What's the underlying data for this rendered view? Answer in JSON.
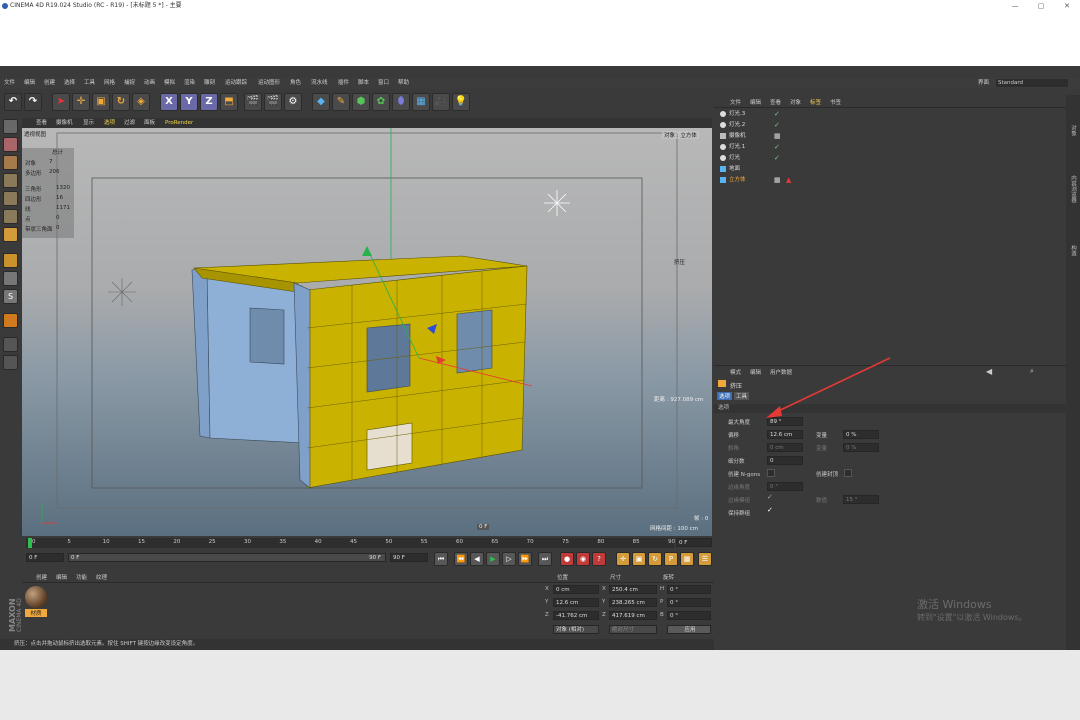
{
  "window": {
    "title": "CINEMA 4D R19.024 Studio (RC - R19) - [未标题 5 *] - 主要",
    "controls": [
      "—",
      "▢",
      "✕"
    ]
  },
  "menu": [
    "文件",
    "编辑",
    "创建",
    "选择",
    "工具",
    "网格",
    "捕捉",
    "动画",
    "模拟",
    "渲染",
    "雕刻",
    "运动跟踪",
    "运动图形",
    "角色",
    "流水线",
    "插件",
    "脚本",
    "窗口",
    "帮助"
  ],
  "layout": {
    "label": "界面",
    "value": "Standard"
  },
  "toolbar": {
    "undo_icon": "undo-icon",
    "axis_labels": [
      "X",
      "Y",
      "Z"
    ]
  },
  "viewport": {
    "tabs": [
      "查看",
      "摄像机",
      "显示",
      "选项",
      "过滤",
      "面板",
      "ProRender"
    ],
    "name": "透视视图",
    "object_label": "对象 : 立方体",
    "tool_label": "挤压",
    "distance": "距离 : 927.089 cm",
    "grid_spacing": "网格间距 : 100 cm",
    "frame_label": "帧 : 0",
    "frame_box": "0 F",
    "stats": {
      "header": "总计",
      "rows": [
        {
          "k": "对象",
          "v": "7"
        },
        {
          "k": "多边形",
          "v": "206"
        },
        {
          "k": "三角形",
          "v": "1320"
        },
        {
          "k": "四边形",
          "v": "16"
        },
        {
          "k": "线",
          "v": "1171"
        },
        {
          "k": "点",
          "v": "0"
        },
        {
          "k": "带状三角面",
          "v": "0"
        }
      ]
    }
  },
  "timeline": {
    "ticks": [
      "0",
      "5",
      "10",
      "15",
      "20",
      "25",
      "30",
      "35",
      "40",
      "45",
      "50",
      "55",
      "60",
      "65",
      "70",
      "75",
      "80",
      "85",
      "90"
    ],
    "current": "0 F",
    "start": "0 F",
    "min": "0 F",
    "max": "90 F",
    "end": "90 F"
  },
  "materials": {
    "menu": [
      "创建",
      "编辑",
      "功能",
      "纹理"
    ],
    "items": [
      {
        "name": "材质"
      }
    ],
    "brand": [
      "MAXON",
      "CINEMA 4D"
    ]
  },
  "coords": {
    "headers": [
      "位置",
      "尺寸",
      "旋转"
    ],
    "rows": [
      {
        "a": "X",
        "pos": "0 cm",
        "b": "X",
        "size": "250.4 cm",
        "c": "H",
        "rot": "0 °"
      },
      {
        "a": "Y",
        "pos": "12.6 cm",
        "b": "Y",
        "size": "238.265 cm",
        "c": "P",
        "rot": "0 °"
      },
      {
        "a": "Z",
        "pos": "-41.762 cm",
        "b": "Z",
        "size": "417.619 cm",
        "c": "B",
        "rot": "0 °"
      }
    ],
    "mode": "对象 (相对)",
    "size_mode": "绝对尺寸",
    "apply": "应用"
  },
  "status": "挤压：点击并拖动鼠标挤出选取元素。按住 SHIFT 键按边缘改变设定角度。",
  "objects": {
    "menu": [
      "文件",
      "编辑",
      "查看",
      "对象",
      "标签",
      "书签"
    ],
    "rows": [
      {
        "name": "灯光.3",
        "color": "#d8d8d8"
      },
      {
        "name": "灯光.2",
        "color": "#d8d8d8"
      },
      {
        "name": "摄像机",
        "color": "#d8d8d8"
      },
      {
        "name": "灯光.1",
        "color": "#d8d8d8"
      },
      {
        "name": "灯光",
        "color": "#d8d8d8"
      },
      {
        "name": "地面",
        "color": "#d8d8d8"
      },
      {
        "name": "立方体",
        "color": "#f2a93b"
      }
    ]
  },
  "attributes": {
    "menu": [
      "模式",
      "编辑",
      "用户数据"
    ],
    "title": "挤压",
    "tabs": [
      "选项",
      "工具"
    ],
    "section": "选项",
    "max_angle_label": "最大角度",
    "max_angle": "89 °",
    "offset_label": "偏移",
    "offset": "12.6 cm",
    "var1_label": "变量",
    "var1": "0 %",
    "bevel_label": "斜角",
    "bevel": "0 cm",
    "var2_label": "变量",
    "var2": "0 %",
    "subdiv_label": "细分数",
    "subdiv": "0",
    "ngons_label": "创建 N-gons",
    "cap_label": "创建封顶",
    "edge_angle_label": "边缘角度",
    "edge_angle": "0 °",
    "edge_mode_label": "边缘模组",
    "value_label": "数值",
    "value": "15 °",
    "keep_groups_label": "保持群组"
  },
  "sidetabs": [
    "对象",
    "内容浏览器",
    "构造"
  ],
  "activate": {
    "line1": "激活 Windows",
    "line2": "转到\"设置\"以激活 Windows。"
  },
  "colors": {
    "accent": "#f2a93b",
    "selected": "#ffb400",
    "arrow": "#e53935",
    "model_yellow": "#c9b200",
    "model_blue": "#7fa0c8"
  }
}
